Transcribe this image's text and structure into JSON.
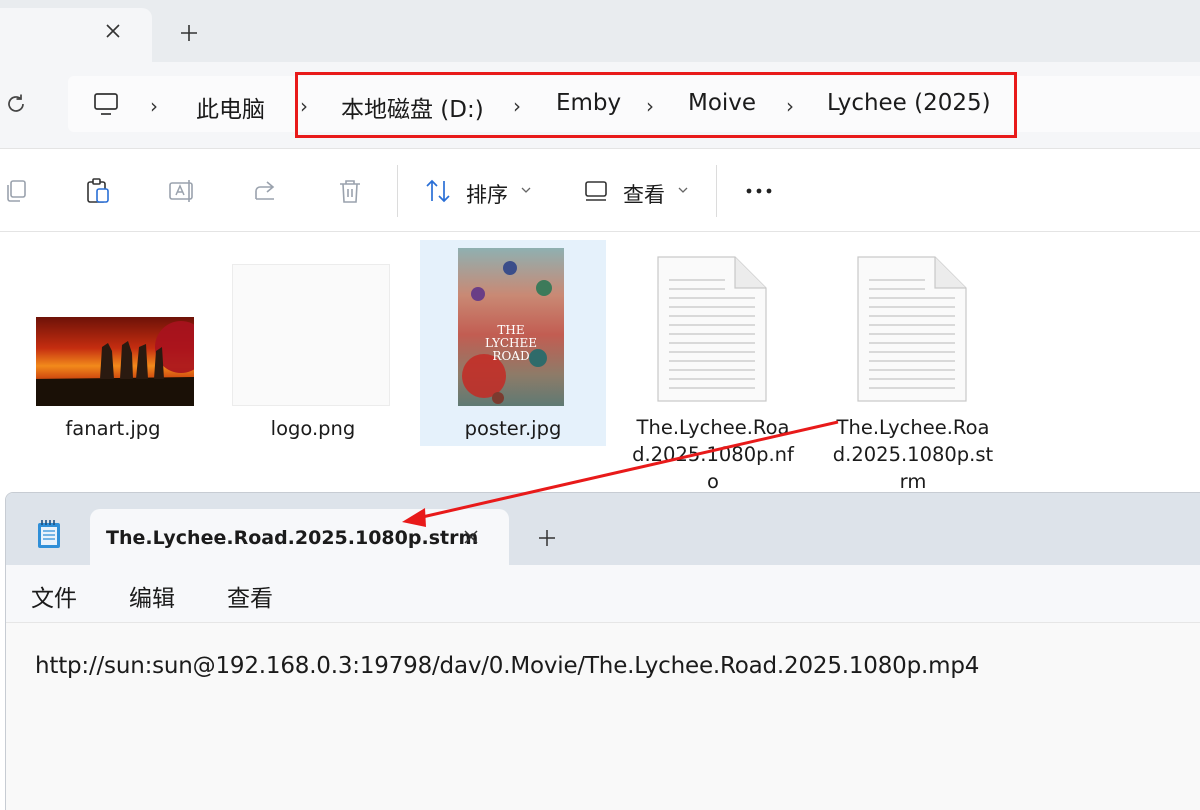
{
  "explorer": {
    "breadcrumb": [
      "此电脑",
      "本地磁盘 (D:)",
      "Emby",
      "Moive",
      "Lychee (2025)"
    ],
    "toolbar": {
      "sort_label": "排序",
      "view_label": "查看"
    },
    "files": [
      {
        "name": "fanart.jpg"
      },
      {
        "name": "logo.png"
      },
      {
        "name": "poster.jpg",
        "selected": true
      },
      {
        "name_lines": [
          "The.Lychee.Roa",
          "d.2025.1080p.nf",
          "o"
        ]
      },
      {
        "name_lines": [
          "The.Lychee.Roa",
          "d.2025.1080p.st",
          "rm"
        ]
      }
    ],
    "poster_text": [
      "THE",
      "LYCHEE",
      "ROAD"
    ]
  },
  "notepad": {
    "tab_title": "The.Lychee.Road.2025.1080p.strm",
    "menu": [
      "文件",
      "编辑",
      "查看"
    ],
    "content": "http://sun:sun@192.168.0.3:19798/dav/0.Movie/The.Lychee.Road.2025.1080p.mp4"
  },
  "colors": {
    "annotation_red": "#e81a1a",
    "selection_blue": "#e5f1fb"
  },
  "icons": [
    "close-icon",
    "plus-icon",
    "refresh-icon",
    "computer-icon",
    "chevron-right-icon",
    "copy-icon",
    "paste-icon",
    "rename-icon",
    "share-icon",
    "delete-icon",
    "sort-icon",
    "view-icon",
    "more-icon",
    "document-icon",
    "notepad-icon"
  ]
}
